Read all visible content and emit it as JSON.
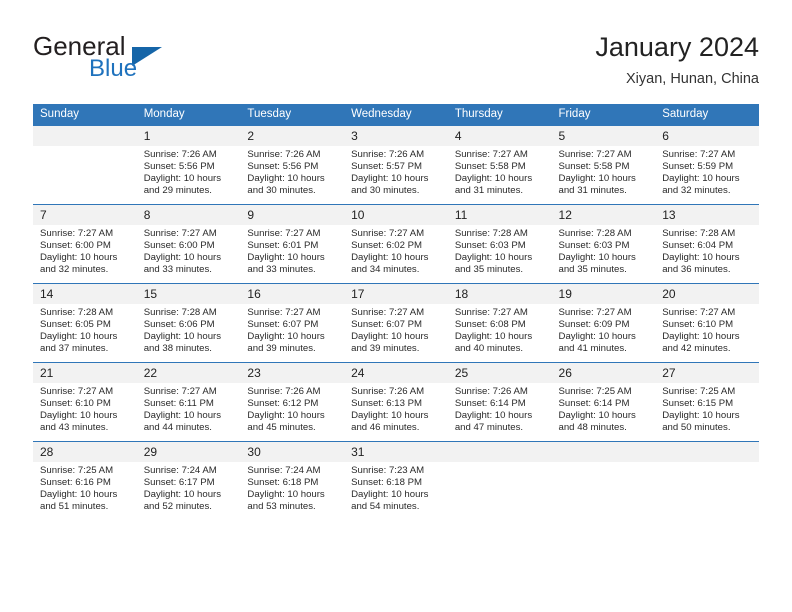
{
  "brand": {
    "name_part1": "General",
    "name_part2": "Blue",
    "triangle_icon": "triangle-logo-icon",
    "accent_color": "#1f72bd"
  },
  "header": {
    "title": "January 2024",
    "subtitle": "Xiyan, Hunan, China"
  },
  "theme": {
    "header_bar_color": "#3076b8",
    "daynum_band_color": "#f2f2f2",
    "text_color": "#2a2a2a"
  },
  "calendar": {
    "weekday_headers": [
      "Sunday",
      "Monday",
      "Tuesday",
      "Wednesday",
      "Thursday",
      "Friday",
      "Saturday"
    ],
    "weeks": [
      [
        {
          "day": "",
          "sunrise": "",
          "sunset": "",
          "daylight_line1": "",
          "daylight_line2": ""
        },
        {
          "day": "1",
          "sunrise": "Sunrise: 7:26 AM",
          "sunset": "Sunset: 5:56 PM",
          "daylight_line1": "Daylight: 10 hours",
          "daylight_line2": "and 29 minutes."
        },
        {
          "day": "2",
          "sunrise": "Sunrise: 7:26 AM",
          "sunset": "Sunset: 5:56 PM",
          "daylight_line1": "Daylight: 10 hours",
          "daylight_line2": "and 30 minutes."
        },
        {
          "day": "3",
          "sunrise": "Sunrise: 7:26 AM",
          "sunset": "Sunset: 5:57 PM",
          "daylight_line1": "Daylight: 10 hours",
          "daylight_line2": "and 30 minutes."
        },
        {
          "day": "4",
          "sunrise": "Sunrise: 7:27 AM",
          "sunset": "Sunset: 5:58 PM",
          "daylight_line1": "Daylight: 10 hours",
          "daylight_line2": "and 31 minutes."
        },
        {
          "day": "5",
          "sunrise": "Sunrise: 7:27 AM",
          "sunset": "Sunset: 5:58 PM",
          "daylight_line1": "Daylight: 10 hours",
          "daylight_line2": "and 31 minutes."
        },
        {
          "day": "6",
          "sunrise": "Sunrise: 7:27 AM",
          "sunset": "Sunset: 5:59 PM",
          "daylight_line1": "Daylight: 10 hours",
          "daylight_line2": "and 32 minutes."
        }
      ],
      [
        {
          "day": "7",
          "sunrise": "Sunrise: 7:27 AM",
          "sunset": "Sunset: 6:00 PM",
          "daylight_line1": "Daylight: 10 hours",
          "daylight_line2": "and 32 minutes."
        },
        {
          "day": "8",
          "sunrise": "Sunrise: 7:27 AM",
          "sunset": "Sunset: 6:00 PM",
          "daylight_line1": "Daylight: 10 hours",
          "daylight_line2": "and 33 minutes."
        },
        {
          "day": "9",
          "sunrise": "Sunrise: 7:27 AM",
          "sunset": "Sunset: 6:01 PM",
          "daylight_line1": "Daylight: 10 hours",
          "daylight_line2": "and 33 minutes."
        },
        {
          "day": "10",
          "sunrise": "Sunrise: 7:27 AM",
          "sunset": "Sunset: 6:02 PM",
          "daylight_line1": "Daylight: 10 hours",
          "daylight_line2": "and 34 minutes."
        },
        {
          "day": "11",
          "sunrise": "Sunrise: 7:28 AM",
          "sunset": "Sunset: 6:03 PM",
          "daylight_line1": "Daylight: 10 hours",
          "daylight_line2": "and 35 minutes."
        },
        {
          "day": "12",
          "sunrise": "Sunrise: 7:28 AM",
          "sunset": "Sunset: 6:03 PM",
          "daylight_line1": "Daylight: 10 hours",
          "daylight_line2": "and 35 minutes."
        },
        {
          "day": "13",
          "sunrise": "Sunrise: 7:28 AM",
          "sunset": "Sunset: 6:04 PM",
          "daylight_line1": "Daylight: 10 hours",
          "daylight_line2": "and 36 minutes."
        }
      ],
      [
        {
          "day": "14",
          "sunrise": "Sunrise: 7:28 AM",
          "sunset": "Sunset: 6:05 PM",
          "daylight_line1": "Daylight: 10 hours",
          "daylight_line2": "and 37 minutes."
        },
        {
          "day": "15",
          "sunrise": "Sunrise: 7:28 AM",
          "sunset": "Sunset: 6:06 PM",
          "daylight_line1": "Daylight: 10 hours",
          "daylight_line2": "and 38 minutes."
        },
        {
          "day": "16",
          "sunrise": "Sunrise: 7:27 AM",
          "sunset": "Sunset: 6:07 PM",
          "daylight_line1": "Daylight: 10 hours",
          "daylight_line2": "and 39 minutes."
        },
        {
          "day": "17",
          "sunrise": "Sunrise: 7:27 AM",
          "sunset": "Sunset: 6:07 PM",
          "daylight_line1": "Daylight: 10 hours",
          "daylight_line2": "and 39 minutes."
        },
        {
          "day": "18",
          "sunrise": "Sunrise: 7:27 AM",
          "sunset": "Sunset: 6:08 PM",
          "daylight_line1": "Daylight: 10 hours",
          "daylight_line2": "and 40 minutes."
        },
        {
          "day": "19",
          "sunrise": "Sunrise: 7:27 AM",
          "sunset": "Sunset: 6:09 PM",
          "daylight_line1": "Daylight: 10 hours",
          "daylight_line2": "and 41 minutes."
        },
        {
          "day": "20",
          "sunrise": "Sunrise: 7:27 AM",
          "sunset": "Sunset: 6:10 PM",
          "daylight_line1": "Daylight: 10 hours",
          "daylight_line2": "and 42 minutes."
        }
      ],
      [
        {
          "day": "21",
          "sunrise": "Sunrise: 7:27 AM",
          "sunset": "Sunset: 6:10 PM",
          "daylight_line1": "Daylight: 10 hours",
          "daylight_line2": "and 43 minutes."
        },
        {
          "day": "22",
          "sunrise": "Sunrise: 7:27 AM",
          "sunset": "Sunset: 6:11 PM",
          "daylight_line1": "Daylight: 10 hours",
          "daylight_line2": "and 44 minutes."
        },
        {
          "day": "23",
          "sunrise": "Sunrise: 7:26 AM",
          "sunset": "Sunset: 6:12 PM",
          "daylight_line1": "Daylight: 10 hours",
          "daylight_line2": "and 45 minutes."
        },
        {
          "day": "24",
          "sunrise": "Sunrise: 7:26 AM",
          "sunset": "Sunset: 6:13 PM",
          "daylight_line1": "Daylight: 10 hours",
          "daylight_line2": "and 46 minutes."
        },
        {
          "day": "25",
          "sunrise": "Sunrise: 7:26 AM",
          "sunset": "Sunset: 6:14 PM",
          "daylight_line1": "Daylight: 10 hours",
          "daylight_line2": "and 47 minutes."
        },
        {
          "day": "26",
          "sunrise": "Sunrise: 7:25 AM",
          "sunset": "Sunset: 6:14 PM",
          "daylight_line1": "Daylight: 10 hours",
          "daylight_line2": "and 48 minutes."
        },
        {
          "day": "27",
          "sunrise": "Sunrise: 7:25 AM",
          "sunset": "Sunset: 6:15 PM",
          "daylight_line1": "Daylight: 10 hours",
          "daylight_line2": "and 50 minutes."
        }
      ],
      [
        {
          "day": "28",
          "sunrise": "Sunrise: 7:25 AM",
          "sunset": "Sunset: 6:16 PM",
          "daylight_line1": "Daylight: 10 hours",
          "daylight_line2": "and 51 minutes."
        },
        {
          "day": "29",
          "sunrise": "Sunrise: 7:24 AM",
          "sunset": "Sunset: 6:17 PM",
          "daylight_line1": "Daylight: 10 hours",
          "daylight_line2": "and 52 minutes."
        },
        {
          "day": "30",
          "sunrise": "Sunrise: 7:24 AM",
          "sunset": "Sunset: 6:18 PM",
          "daylight_line1": "Daylight: 10 hours",
          "daylight_line2": "and 53 minutes."
        },
        {
          "day": "31",
          "sunrise": "Sunrise: 7:23 AM",
          "sunset": "Sunset: 6:18 PM",
          "daylight_line1": "Daylight: 10 hours",
          "daylight_line2": "and 54 minutes."
        },
        {
          "day": "",
          "sunrise": "",
          "sunset": "",
          "daylight_line1": "",
          "daylight_line2": ""
        },
        {
          "day": "",
          "sunrise": "",
          "sunset": "",
          "daylight_line1": "",
          "daylight_line2": ""
        },
        {
          "day": "",
          "sunrise": "",
          "sunset": "",
          "daylight_line1": "",
          "daylight_line2": ""
        }
      ]
    ]
  }
}
